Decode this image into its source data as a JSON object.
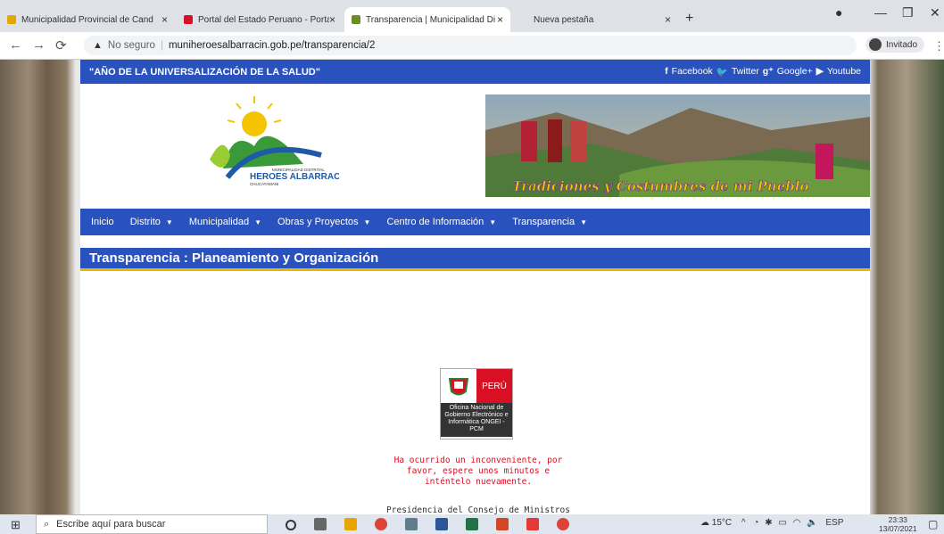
{
  "browser": {
    "tabs": [
      {
        "title": "Municipalidad Provincial de Cand",
        "favicon_color": "#e0a800"
      },
      {
        "title": "Portal del Estado Peruano - Porta",
        "favicon_color": "#d91023"
      },
      {
        "title": "Transparencia | Municipalidad Di",
        "favicon_color": "#6b8e23",
        "active": true
      },
      {
        "title": "Nueva pestaña",
        "favicon_color": "#ffffff"
      }
    ],
    "new_tab": "+",
    "security_label": "No seguro",
    "url": "muniheroesalbarracin.gob.pe/transparencia/2",
    "profile": "Invitado"
  },
  "site": {
    "year_motto": "\"AÑO DE LA UNIVERSALIZACIÓN DE LA SALUD\"",
    "social": [
      "Facebook",
      "Twitter",
      "Google+",
      "Youtube"
    ],
    "logo_text_line1": "MUNICIPALIDAD DISTRITAL",
    "logo_text_line2": "HEROES ALBARRACIN",
    "logo_text_line3": "CHUCATAMANI",
    "banner_caption": "Tradiciones y Costumbres de mi Pueblo",
    "nav": [
      {
        "label": "Inicio",
        "dropdown": false
      },
      {
        "label": "Distrito",
        "dropdown": true
      },
      {
        "label": "Municipalidad",
        "dropdown": true
      },
      {
        "label": "Obras y Proyectos",
        "dropdown": true
      },
      {
        "label": "Centro de Información",
        "dropdown": true
      },
      {
        "label": "Transparencia",
        "dropdown": true
      }
    ],
    "section_title": "Transparencia : Planeamiento y Organización",
    "ongei_peru": "PERÚ",
    "ongei_text": "Oficina Nacional de Gobierno Electrónico e Informática ONGEI - PCM",
    "error_message": "Ha ocurrido un inconveniente, por favor, espere unos minutos e inténtelo nuevamente.",
    "footer_partial": "Presidencia del Consejo de Ministros"
  },
  "taskbar": {
    "search_placeholder": "Escribe aquí para buscar",
    "temperature": "15°C",
    "language": "ESP",
    "time": "23:33",
    "date": "13/07/2021"
  }
}
